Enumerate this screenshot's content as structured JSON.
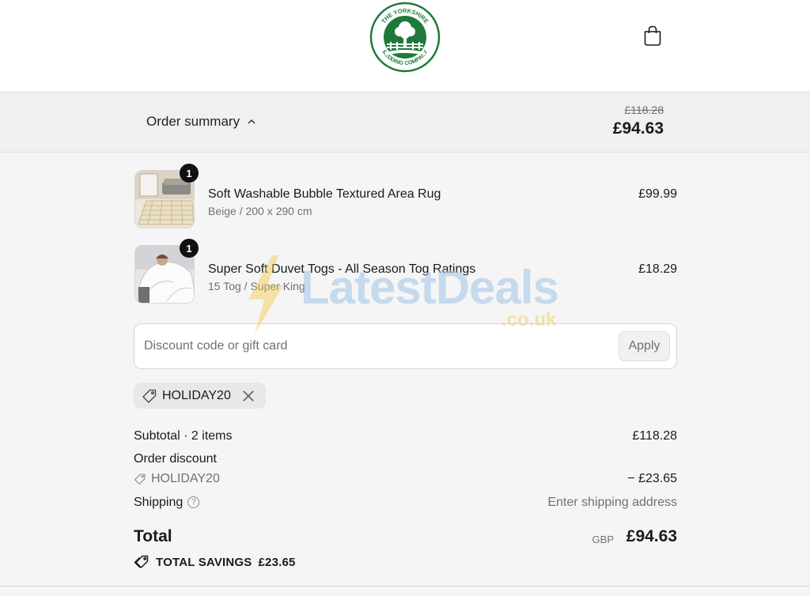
{
  "header": {
    "brand_line1": "THE YORKSHIRE",
    "brand_line2": "BEDDING COMPANY",
    "logo_color": "#1e7a3c"
  },
  "summary_bar": {
    "toggle_label": "Order summary",
    "original_total": "£118.28",
    "total": "£94.63"
  },
  "items": [
    {
      "title": "Soft Washable Bubble Textured Area Rug",
      "variant": "Beige / 200 x 290 cm",
      "price": "£99.99",
      "quantity": "1"
    },
    {
      "title": "Super Soft Duvet Togs - All Season Tog Ratings",
      "variant": "15 Tog / Super King",
      "price": "£18.29",
      "quantity": "1"
    }
  ],
  "discount": {
    "placeholder": "Discount code or gift card",
    "apply_label": "Apply",
    "applied_code": "HOLIDAY20"
  },
  "totals": {
    "subtotal_label": "Subtotal · 2 items",
    "subtotal_value": "£118.28",
    "discount_label": "Order discount",
    "discount_code": "HOLIDAY20",
    "discount_value": "− £23.65",
    "shipping_label": "Shipping",
    "shipping_value": "Enter shipping address",
    "total_label": "Total",
    "currency": "GBP",
    "total_value": "£94.63",
    "savings_label": "TOTAL SAVINGS",
    "savings_value": "£23.65"
  },
  "watermark": {
    "text": "LatestDeals",
    "sub": ".co.uk"
  }
}
